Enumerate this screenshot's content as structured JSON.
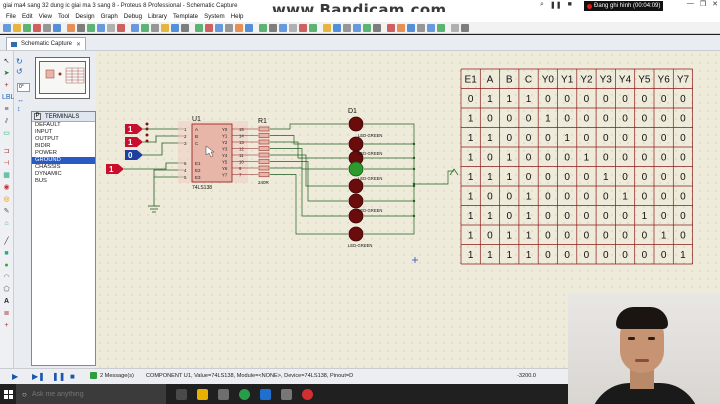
{
  "window": {
    "title": "giai ma4 sang 32 dung ic giai ma 3 sang 8 - Proteus 8 Professional - Schematic Capture",
    "watermark": "www.Bandicam.com",
    "recording_text": "Đang ghi hình (00:04:09)"
  },
  "menu": [
    "File",
    "Edit",
    "View",
    "Tool",
    "Design",
    "Graph",
    "Debug",
    "Library",
    "Template",
    "System",
    "Help"
  ],
  "tab": {
    "label": "Schematic Capture"
  },
  "side_panel": {
    "rotation_value": "0°",
    "terminals_title": "TERMINALS",
    "terminals_button": "P",
    "items": [
      "DEFAULT",
      "INPUT",
      "OUTPUT",
      "BIDIR",
      "POWER",
      "GROUND",
      "CHASSIS",
      "DYNAMIC",
      "BUS"
    ],
    "selected_item": "GROUND"
  },
  "schematic": {
    "ic": {
      "ref": "U1",
      "part": "74LS138",
      "left_pins": [
        "1",
        "2",
        "3",
        "6",
        "4",
        "5"
      ],
      "left_pin_names": [
        "A",
        "B",
        "C",
        "E1",
        "E2",
        "E3"
      ],
      "right_pin_names": [
        "Y0",
        "Y1",
        "Y2",
        "Y3",
        "Y4",
        "Y5",
        "Y6",
        "Y7"
      ],
      "right_pins": [
        "15",
        "14",
        "13",
        "12",
        "11",
        "10",
        "9",
        "7"
      ]
    },
    "resistor": {
      "ref": "R1",
      "value": "240R"
    },
    "leds": {
      "ref": "D1",
      "label": "LED-GREEN"
    },
    "inputs": [
      "1",
      "1",
      "0",
      "1"
    ],
    "truth_table": {
      "headers": [
        "E1",
        "A",
        "B",
        "C",
        "Y0",
        "Y1",
        "Y2",
        "Y3",
        "Y4",
        "Y5",
        "Y6",
        "Y7"
      ],
      "rows": [
        [
          "0",
          "1",
          "1",
          "1",
          "0",
          "0",
          "0",
          "0",
          "0",
          "0",
          "0",
          "0"
        ],
        [
          "1",
          "0",
          "0",
          "0",
          "1",
          "0",
          "0",
          "0",
          "0",
          "0",
          "0",
          "0"
        ],
        [
          "1",
          "1",
          "0",
          "0",
          "0",
          "1",
          "0",
          "0",
          "0",
          "0",
          "0",
          "0"
        ],
        [
          "1",
          "0",
          "1",
          "0",
          "0",
          "0",
          "1",
          "0",
          "0",
          "0",
          "0",
          "0"
        ],
        [
          "1",
          "1",
          "1",
          "0",
          "0",
          "0",
          "0",
          "1",
          "0",
          "0",
          "0",
          "0"
        ],
        [
          "1",
          "0",
          "0",
          "1",
          "0",
          "0",
          "0",
          "0",
          "1",
          "0",
          "0",
          "0"
        ],
        [
          "1",
          "1",
          "0",
          "1",
          "0",
          "0",
          "0",
          "0",
          "0",
          "1",
          "0",
          "0"
        ],
        [
          "1",
          "0",
          "1",
          "1",
          "0",
          "0",
          "0",
          "0",
          "0",
          "0",
          "1",
          "0"
        ],
        [
          "1",
          "1",
          "1",
          "1",
          "0",
          "0",
          "0",
          "0",
          "0",
          "0",
          "0",
          "1"
        ]
      ]
    }
  },
  "status": {
    "messages": "2 Message(s)",
    "component": "COMPONENT U1, Value=74LS138, Module=<NONE>, Device=74LS138, Pinout=D",
    "coord": "-3200.0"
  },
  "taskbar": {
    "search_placeholder": "Ask me anything"
  },
  "colors": {
    "canvas": "#efebda",
    "wire": "#1f5e1f",
    "ic_body": "#e8b6a8",
    "table_line": "#8b1a1a",
    "led": "#8b0f0f"
  }
}
